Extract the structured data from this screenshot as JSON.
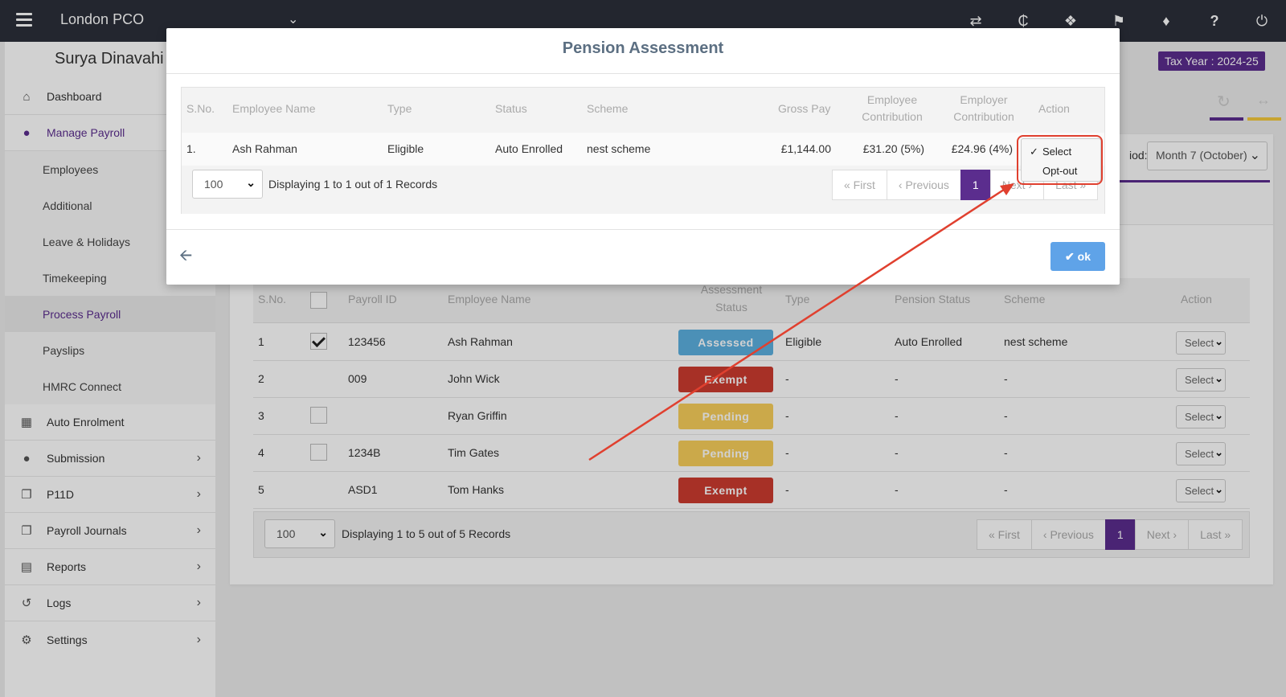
{
  "topbar": {
    "org_name": "London PCO",
    "icons": [
      "menu-icon",
      "chevron-down-icon",
      "switch-icon",
      "currency-icon",
      "cubes-icon",
      "megaphone-icon",
      "ticket-icon",
      "help-icon",
      "power-icon"
    ],
    "help_glyph": "?"
  },
  "sidebar": {
    "user_name": "Surya Dinavahi",
    "items": [
      {
        "label": "Dashboard",
        "icon": "home-icon"
      },
      {
        "label": "Manage Payroll",
        "icon": "user-icon"
      },
      {
        "label": "Auto Enrolment",
        "icon": "grid-icon"
      },
      {
        "label": "Submission",
        "icon": "users-icon"
      },
      {
        "label": "P11D",
        "icon": "copy-icon"
      },
      {
        "label": "Payroll Journals",
        "icon": "copy-icon"
      },
      {
        "label": "Reports",
        "icon": "report-icon"
      },
      {
        "label": "Logs",
        "icon": "history-icon"
      },
      {
        "label": "Settings",
        "icon": "gear-icon"
      }
    ],
    "sub_items": [
      "Employees",
      "Additional",
      "Leave & Holidays",
      "Timekeeping",
      "Process Payroll",
      "Payslips",
      "HMRC Connect"
    ]
  },
  "header": {
    "tax_year": "Tax Year : 2024-25",
    "period_label": "iod:",
    "period_value": "Month 7 (October)"
  },
  "grid": {
    "columns": [
      "S.No.",
      "Payroll ID",
      "Employee Name",
      "Assessment",
      "Status",
      "Type",
      "Pension Status",
      "Scheme",
      "Action"
    ],
    "rows": [
      {
        "sno": "1",
        "checked": true,
        "payroll_id": "123456",
        "name": "Ash Rahman",
        "assessment": "Assessed",
        "type": "Eligible",
        "pension_status": "Auto Enrolled",
        "scheme": "nest scheme",
        "action": "Select"
      },
      {
        "sno": "2",
        "checked": null,
        "payroll_id": "009",
        "name": "John Wick",
        "assessment": "Exempt",
        "type": "-",
        "pension_status": "-",
        "scheme": "-",
        "action": "Select"
      },
      {
        "sno": "3",
        "checked": false,
        "payroll_id": "",
        "name": "Ryan Griffin",
        "assessment": "Pending",
        "type": "-",
        "pension_status": "-",
        "scheme": "-",
        "action": "Select"
      },
      {
        "sno": "4",
        "checked": false,
        "payroll_id": "1234B",
        "name": "Tim Gates",
        "assessment": "Pending",
        "type": "-",
        "pension_status": "-",
        "scheme": "-",
        "action": "Select"
      },
      {
        "sno": "5",
        "checked": null,
        "payroll_id": "ASD1",
        "name": "Tom Hanks",
        "assessment": "Exempt",
        "type": "-",
        "pension_status": "-",
        "scheme": "-",
        "action": "Select"
      }
    ],
    "page_size": "100",
    "displaying": "Displaying 1 to 5 out of 5 Records",
    "pager": {
      "first": "« First",
      "previous": "‹ Previous",
      "current": "1",
      "next": "Next ›",
      "last": "Last »"
    }
  },
  "modal": {
    "title": "Pension Assessment",
    "columns": {
      "sno": "S.No.",
      "name": "Employee Name",
      "type": "Type",
      "status": "Status",
      "scheme": "Scheme",
      "gross": "Gross Pay",
      "emp_contrib_1": "Employee",
      "emp_contrib_2": "Contribution",
      "er_contrib_1": "Employer",
      "er_contrib_2": "Contribution",
      "action": "Action"
    },
    "row": {
      "sno": "1.",
      "name": "Ash Rahman",
      "type": "Eligible",
      "status": "Auto Enrolled",
      "scheme": "nest scheme",
      "gross": "£1,144.00",
      "emp_contrib": "£31.20 (5%)",
      "er_contrib": "£24.96 (4%)"
    },
    "page_size": "100",
    "displaying": "Displaying 1 to 1 out of 1 Records",
    "pager": {
      "first": "« First",
      "previous": "‹ Previous",
      "current": "1",
      "next": "Next ›",
      "last": "Last »"
    },
    "dropdown_options": [
      {
        "label": "Select",
        "checked": true
      },
      {
        "label": "Opt-out",
        "checked": false
      }
    ],
    "ok_label": "ok"
  },
  "colors": {
    "accent": "#5b2d8e",
    "assessed": "#5cb0e0",
    "exempt": "#cc3b2f",
    "pending": "#f8cf5b",
    "annotation": "#e0402f",
    "ok": "#5fa3e8"
  }
}
